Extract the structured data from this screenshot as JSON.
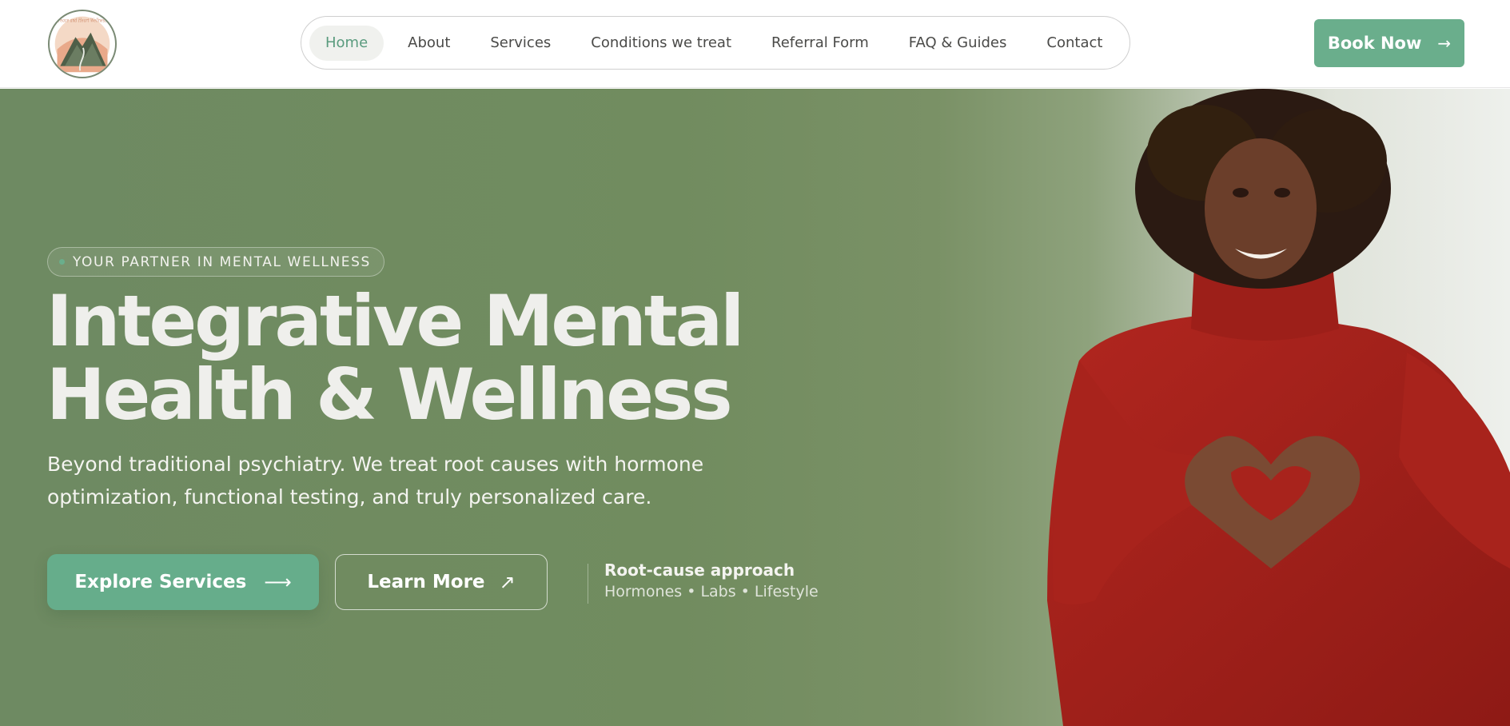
{
  "header": {
    "logo_text": "Peace and Heart Wellness",
    "nav": [
      {
        "label": "Home",
        "active": true
      },
      {
        "label": "About"
      },
      {
        "label": "Services"
      },
      {
        "label": "Conditions we treat"
      },
      {
        "label": "Referral Form"
      },
      {
        "label": "FAQ & Guides"
      },
      {
        "label": "Contact"
      }
    ],
    "book_button": {
      "label": "Book Now",
      "icon": "arrow-right-icon"
    }
  },
  "hero": {
    "eyebrow": "YOUR PARTNER IN MENTAL WELLNESS",
    "title_line1": "Integrative Mental",
    "title_line2": "Health & Wellness",
    "subtitle": "Beyond traditional psychiatry. We treat root causes with hormone optimization, functional testing, and truly personalized care.",
    "primary_button": {
      "label": "Explore Services",
      "icon": "arrow-right-icon"
    },
    "secondary_button": {
      "label": "Learn More",
      "icon": "arrow-up-right-icon"
    },
    "note_title": "Root-cause approach",
    "note_subtitle": "Hormones • Labs • Lifestyle"
  },
  "colors": {
    "accent": "#6aae8c",
    "hero_green": "#718c5f",
    "sweater_red": "#a3211b"
  }
}
